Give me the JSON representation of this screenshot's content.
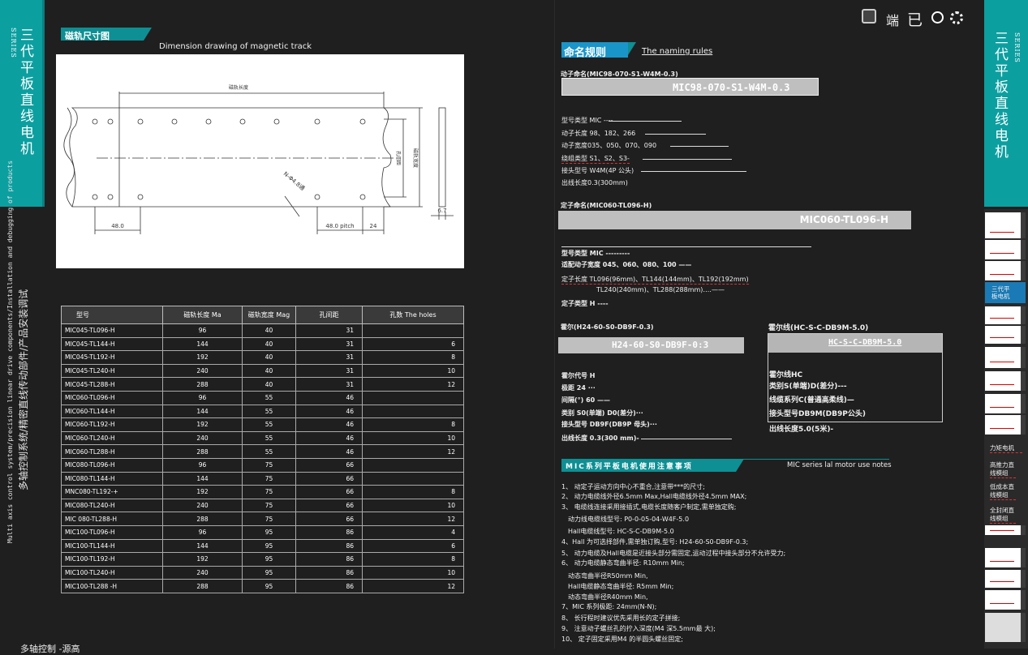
{
  "left_tab": {
    "title": "三代平板直线电机",
    "series_label": "SERIES"
  },
  "left_rotated": {
    "line1": "多轴控制系统/精密直线传动部件/产品安装调试",
    "line2": "Multi axis control system/precision linear drive components/Installation and debugging of products"
  },
  "drawing_section": {
    "heading": "磁轨尺寸图",
    "title": "Dimension drawing of magnetic track",
    "labels": {
      "length": "磁轨长度",
      "hole_dist": "孔间距",
      "width": "磁轨宽度",
      "holes": "N-Φ4.8通",
      "dim48": "48.0",
      "pitch": "48.0 pitch",
      "dim24": "24",
      "dim67": "6.7"
    }
  },
  "spec_table": {
    "headers": [
      "型号",
      "磁轨长度 Ma",
      "磁轨宽度 Mag",
      "孔间距 ",
      "孔数 The holes"
    ],
    "rows": [
      [
        "MIC045-TL096-H",
        "96",
        "40",
        "31",
        ""
      ],
      [
        "MIC045-TL144-H",
        "144",
        "40",
        "31",
        "6"
      ],
      [
        "MIC045-TL192-H",
        "192",
        "40",
        "31",
        "8"
      ],
      [
        "MIC045-TL240-H",
        "240",
        "40",
        "31",
        "10"
      ],
      [
        "MIC045-TL288-H",
        "288",
        "40",
        "31",
        "12"
      ],
      [
        "MIC060-TL096-H",
        "96",
        "55",
        "46",
        ""
      ],
      [
        "MIC060-TL144-H",
        "144",
        "55",
        "46",
        ""
      ],
      [
        "MIC060-TL192-H",
        "192",
        "55",
        "46",
        "8"
      ],
      [
        "MIC060-TL240-H",
        "240",
        "55",
        "46",
        "10"
      ],
      [
        "MIC060-TL288-H",
        "288",
        "55",
        "46",
        "12"
      ],
      [
        "MIC080-TL096-H",
        "96",
        "75",
        "66",
        ""
      ],
      [
        "MIC080-TL144-H",
        "144",
        "75",
        "66",
        ""
      ],
      [
        "MNC080-TL192-+",
        "192",
        "75",
        "66",
        "8"
      ],
      [
        "MIC080-TL240-H",
        "240",
        "75",
        "66",
        "10"
      ],
      [
        "MIC 080-TL288-H",
        "288",
        "75",
        "66",
        "12"
      ],
      [
        "MIC100-TL096-H",
        "96",
        "95",
        "86",
        "4"
      ],
      [
        "MIC100-TL144-H",
        "144",
        "95",
        "86",
        "6"
      ],
      [
        "MIC100-TL192-H",
        "192",
        "95",
        "86",
        "8"
      ],
      [
        "MIC100-TL240-H",
        "240",
        "95",
        "86",
        "10"
      ],
      [
        "MIC100-TL288 -H",
        "288",
        "95",
        "86",
        "12"
      ]
    ]
  },
  "header_icons": {
    "text1": "端",
    "text2": "已"
  },
  "naming": {
    "heading": "命名规则",
    "english": "The naming rules",
    "mover_title": "动子命名(MIC98-070-S1-W4M-0.3)",
    "mover_code": "MIC98-070-S1-W4M-0.3",
    "mover_lines": [
      "型号类型 MIC ----",
      "动子长度 98、182、266",
      "动子宽度035、050、070、090",
      "绕组类型 S1、S2、S3-",
      "接头型号 W4M(4P 公头)",
      "出线长度0.3(300mm)"
    ],
    "stator_title": "定子命名(MIC060-TL096-H)",
    "stator_code": "MIC060-TL096-H",
    "stator_lines": [
      "型号类型 MIC ---------",
      "适配动子宽度 045、060、080、100 ——",
      "定子长度 TL096(96mm)、TL144(144mm)、TL192(192mm)",
      "TL240(240mm)、TL288(288mm)….——",
      "定子类型 H ----"
    ],
    "hall_title": "霍尔(H24-60-S0-DB9F-0.3)",
    "hall_code": "H24-60-S0-DB9F-0:3",
    "hall_lines": [
      "霍尔代号 H",
      "极距 24 ···",
      "间隔(°) 60 ——",
      "类别 S0(单端) D0(差分)···",
      "接头型号 DB9F(DB9P 母头)···",
      "出线长度 0.3(300 mm)-"
    ],
    "hallcable_title": "霍尔线(HC-S-C-DB9M-5.0)",
    "hallcable_code": "HC-S-C-DB9M-5.0",
    "hallcable_lines": [
      "霍尔线HC",
      "类别S(单端)D(差分)---",
      "线缆系列C(普通高柔线)—",
      "接头型号DB9M(DB9P公头)",
      "出线长度5.0(5米)-"
    ]
  },
  "notes": {
    "heading": "MIC系列平板电机使用注意事项",
    "english": "MIC series lal motor use notes",
    "items": [
      "1、 动定子运动方向中心不重合,注意带***的尺寸;",
      "2、 动力电缆线外径6.5mm  Max,Hall电缆线外径4.5mm MAX;",
      "3、 电缆线连接采用接插式,电缆长度随客户制定,需单独定购;",
      "   动力线电缆线型号:  P0-0-05-04-W4F-5.0",
      "   Hall电缆线型号: HC-S-C-DB9M-5.0",
      "4、Hall 为可选择部件,需单独订购,型号: H24-60-S0-DB9F-0.3;",
      "5、 动力电缆及Hall电缆是近接头部分需固定,运动过程中接头部分不允许受力;",
      "6、 动力电缆静态弯曲半径: R10mm  Min;",
      "   动态弯曲半径R50mm  Min,",
      "   Hall电缆静态弯曲半径: R5mm  Min;",
      "   动态弯曲半径R40mm  Min,",
      "7、MIC 系列极距: 24mm(N-N);",
      "8、 长行程时建议优先采用长的定子拼接;",
      "9、 注意动子螺丝孔的拧入深度(M4 深5.5mm最 大);",
      "10、 定子固定采用M4 的半圆头螺丝固定;"
    ]
  },
  "right_tab": {
    "title": "三代平板直线电机",
    "series_label": "SERIES"
  },
  "right_sidebar": [
    "三代平板电机",
    "力矩电机",
    "高推力直线模组",
    "低成本直线模组",
    "全封闭直线模组"
  ],
  "bottom_left": "多轴控制 -源高"
}
